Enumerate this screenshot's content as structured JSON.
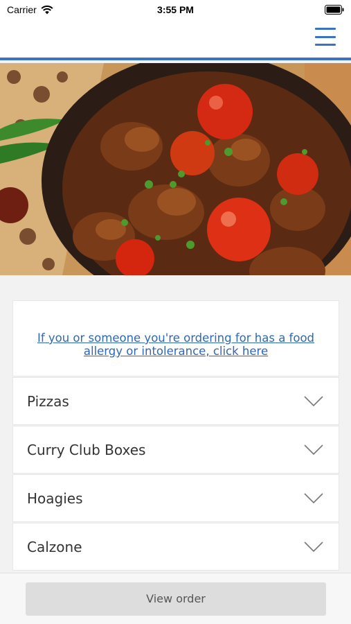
{
  "status_bar": {
    "carrier": "Carrier",
    "time": "3:55 PM",
    "wifi_icon": "wifi-icon",
    "battery_icon": "battery-icon"
  },
  "header": {
    "menu_icon": "hamburger-menu-icon",
    "accent_color": "#3b73c4"
  },
  "hero": {
    "image": "curry-dish-photo"
  },
  "allergy": {
    "link_text": "If you or someone you're ordering for has a food allergy or intolerance, click here"
  },
  "categories": [
    {
      "label": "Pizzas"
    },
    {
      "label": "Curry Club Boxes"
    },
    {
      "label": "Hoagies"
    },
    {
      "label": "Calzone"
    }
  ],
  "footer": {
    "view_order_label": "View order"
  }
}
